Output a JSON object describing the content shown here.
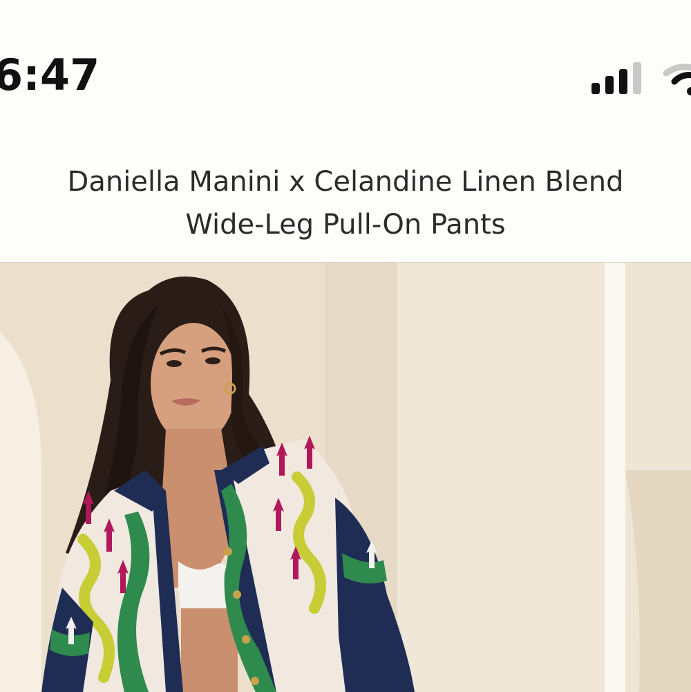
{
  "status_bar": {
    "time": "6:47",
    "signal_icon": "cellular-signal-icon",
    "wifi_icon": "wifi-icon"
  },
  "product": {
    "title_line1": "Daniella Manini x Celandine Linen Blend",
    "title_line2": "Wide-Leg Pull-On Pants"
  },
  "gallery": {
    "image": "product-photo-model-wearing-printed-linen-shirt"
  },
  "colors": {
    "background": "#fdfdf9",
    "text": "#2b2b2b",
    "wall": "#ece0cc",
    "shirt_navy": "#1f2d55",
    "shirt_green": "#2f8a4e",
    "shirt_magenta": "#b0185a",
    "shirt_lime": "#c8cc35"
  }
}
